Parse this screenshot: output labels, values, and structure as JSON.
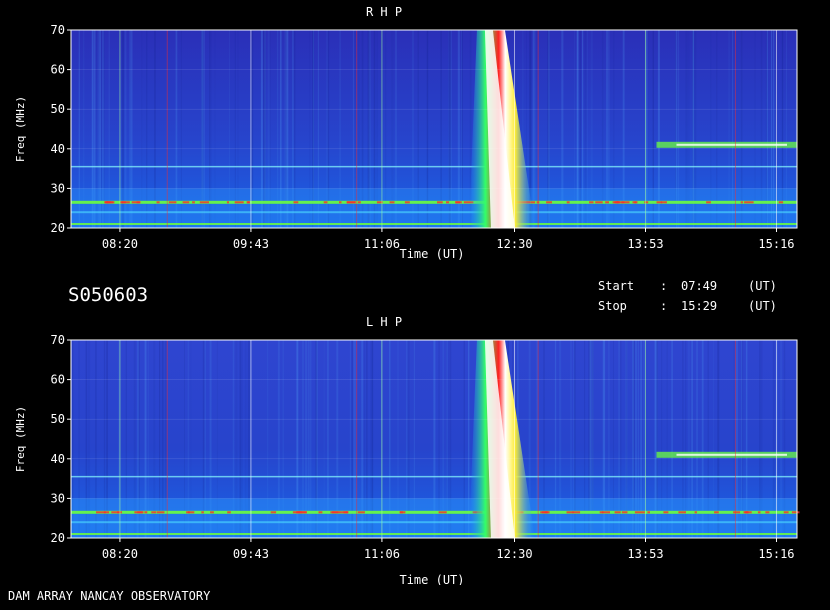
{
  "header": {
    "station": "S050603",
    "footer_left": "DAM ARRAY  NANCAY OBSERVATORY",
    "start_label": "Start",
    "start_sep": ":",
    "start_time": "07:49",
    "start_unit": "(UT)",
    "stop_label": "Stop",
    "stop_sep": ":",
    "stop_time": "15:29",
    "stop_unit": "(UT)"
  },
  "chart_data": [
    {
      "type": "heatmap",
      "title": "R H P",
      "xlabel": "Time (UT)",
      "ylabel": "Freq (MHz)",
      "x_ticks": [
        "08:20",
        "09:43",
        "11:06",
        "12:30",
        "13:53",
        "15:16"
      ],
      "y_ticks": [
        20,
        30,
        40,
        50,
        60,
        70
      ],
      "xlim": [
        "07:49",
        "15:29"
      ],
      "ylim": [
        20,
        70
      ],
      "burst_time": "12:10",
      "bands_mhz": [
        21,
        24,
        26.5,
        35.5,
        41
      ]
    },
    {
      "type": "heatmap",
      "title": "L H P",
      "xlabel": "Time (UT)",
      "ylabel": "Freq (MHz)",
      "x_ticks": [
        "08:20",
        "09:43",
        "11:06",
        "12:30",
        "13:53",
        "15:16"
      ],
      "y_ticks": [
        20,
        30,
        40,
        50,
        60,
        70
      ],
      "xlim": [
        "07:49",
        "15:29"
      ],
      "ylim": [
        20,
        70
      ],
      "burst_time": "12:10",
      "bands_mhz": [
        21,
        24,
        26.5,
        35.5,
        41
      ]
    }
  ],
  "colors": {
    "background": "#000000",
    "spectrum_low": "#2a2fb8",
    "spectrum_mid": "#1f8cff",
    "spectrum_high": "#ffffff",
    "band_green": "#6cff3c",
    "band_red": "#ff2b2b",
    "grid": "#a0ffa0"
  }
}
